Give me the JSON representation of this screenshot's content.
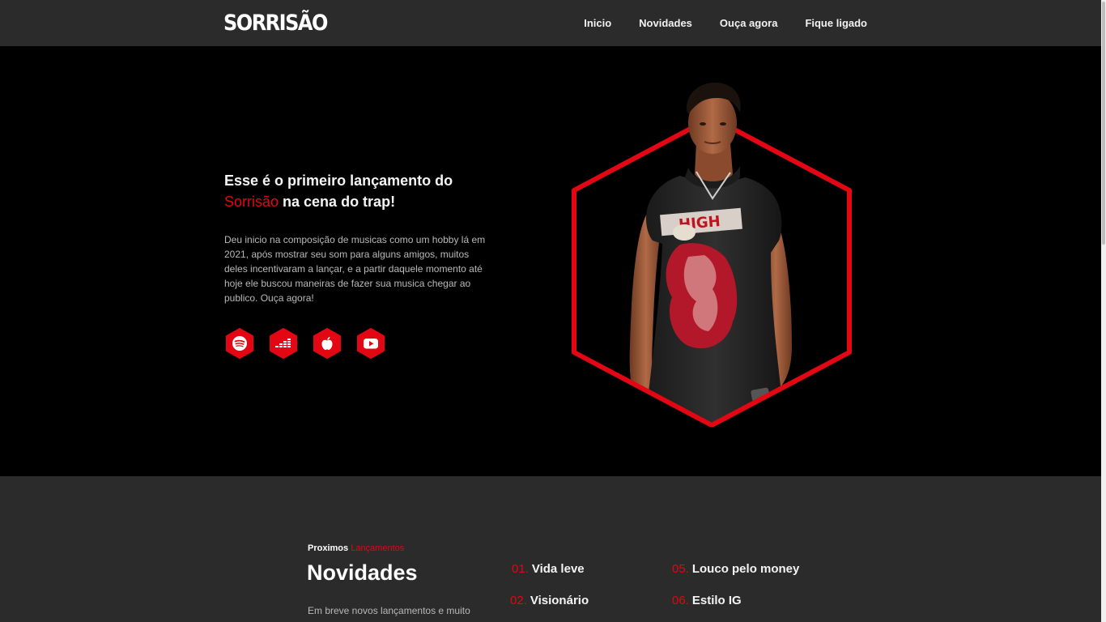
{
  "header": {
    "logo": "Sorrisão",
    "nav": [
      "Inicio",
      "Novidades",
      "Ouça agora",
      "Fique ligado"
    ]
  },
  "hero": {
    "headline_pre": "Esse é o primeiro lançamento do",
    "headline_accent": "Sorrisão",
    "headline_post": " na cena do trap!",
    "description": "Deu inicio na composição de musicas como um hobby lá em 2021, após mostrar seu som para alguns amigos, muitos deles incentivaram a lançar, e a partir daquele momento até hoje ele buscou maneiras de fazer sua musica chegar ao publico. Ouça agora!",
    "socials": [
      {
        "name": "spotify",
        "icon": "spotify-icon"
      },
      {
        "name": "deezer",
        "icon": "deezer-icon"
      },
      {
        "name": "apple-music",
        "icon": "apple-icon"
      },
      {
        "name": "youtube",
        "icon": "youtube-icon"
      }
    ],
    "shirt_text": "HIGH"
  },
  "news": {
    "kicker_pre": "Proximos",
    "kicker_accent": "Lançamentos",
    "title": "Novidades",
    "text": "Em breve novos lançamentos e muito",
    "tracks": [
      {
        "num": "01.",
        "name": "Vida leve"
      },
      {
        "num": "02.",
        "name": "Visionário"
      },
      {
        "num": "05.",
        "name": "Louco pelo money"
      },
      {
        "num": "06.",
        "name": "Estilo IG"
      }
    ]
  },
  "colors": {
    "accent": "#e30613",
    "header_bg": "#2b2b2b",
    "hero_bg": "#000000",
    "section_bg": "#2b2b2b"
  }
}
